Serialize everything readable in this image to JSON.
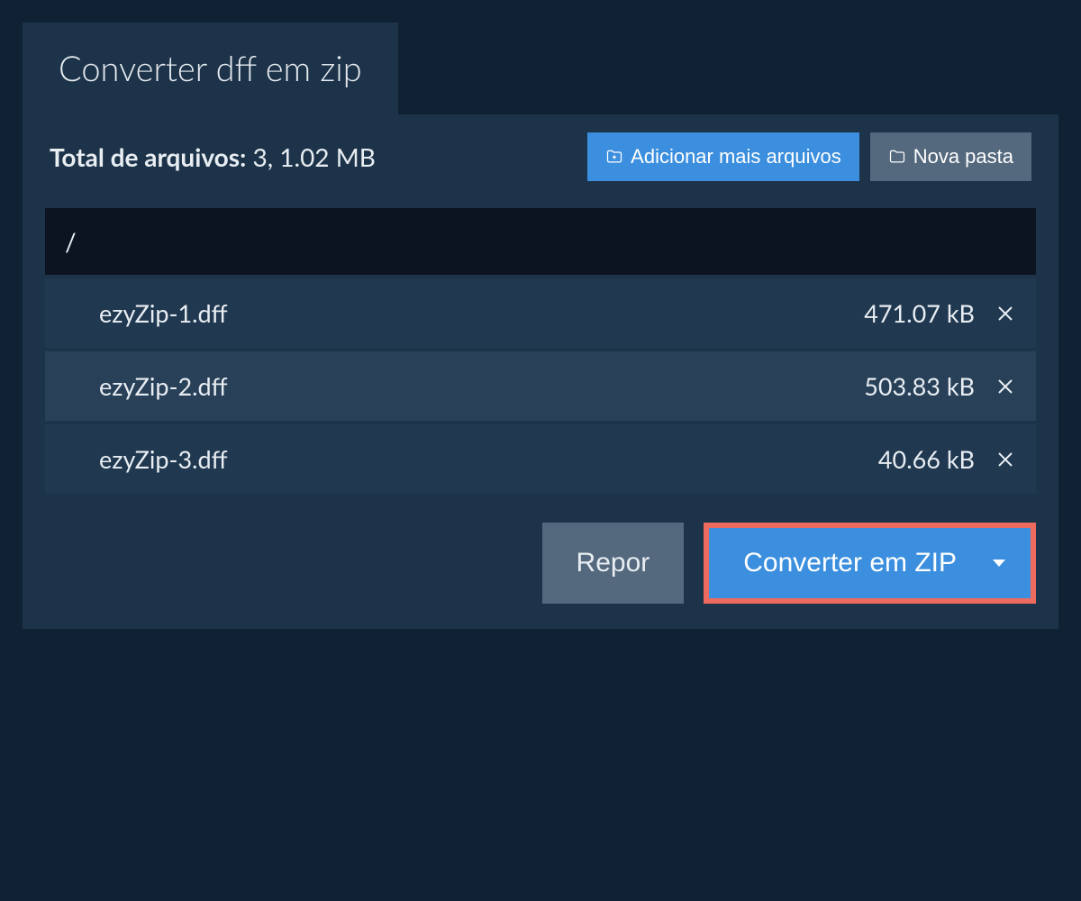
{
  "tab": {
    "title": "Converter dff em zip"
  },
  "summary": {
    "label": "Total de arquivos:",
    "value": "3, 1.02 MB"
  },
  "buttons": {
    "add_more": "Adicionar mais arquivos",
    "new_folder": "Nova pasta",
    "reset": "Repor",
    "convert": "Converter em ZIP"
  },
  "path": "/",
  "files": [
    {
      "name": "ezyZip-1.dff",
      "size": "471.07 kB"
    },
    {
      "name": "ezyZip-2.dff",
      "size": "503.83 kB"
    },
    {
      "name": "ezyZip-3.dff",
      "size": "40.66 kB"
    }
  ]
}
